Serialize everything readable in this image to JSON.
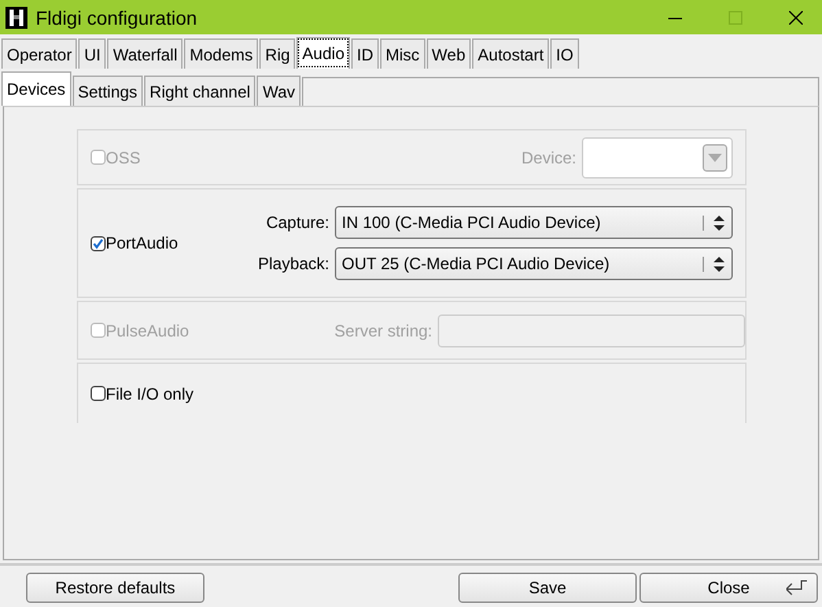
{
  "window": {
    "title": "Fldigi configuration"
  },
  "main_tabs": [
    {
      "label": "Operator",
      "selected": false
    },
    {
      "label": "UI",
      "selected": false
    },
    {
      "label": "Waterfall",
      "selected": false
    },
    {
      "label": "Modems",
      "selected": false
    },
    {
      "label": "Rig",
      "selected": false
    },
    {
      "label": "Audio",
      "selected": true
    },
    {
      "label": "ID",
      "selected": false
    },
    {
      "label": "Misc",
      "selected": false
    },
    {
      "label": "Web",
      "selected": false
    },
    {
      "label": "Autostart",
      "selected": false
    },
    {
      "label": "IO",
      "selected": false
    }
  ],
  "sub_tabs": [
    {
      "label": "Devices",
      "selected": true
    },
    {
      "label": "Settings",
      "selected": false
    },
    {
      "label": "Right channel",
      "selected": false
    },
    {
      "label": "Wav",
      "selected": false
    }
  ],
  "groups": [
    {
      "kind": "device",
      "label": "OSS",
      "checked": false,
      "disabled": true,
      "field_label": "Device:"
    },
    {
      "kind": "portaudio",
      "label": "PortAudio",
      "checked": true,
      "disabled": false,
      "capture_label": "Capture:",
      "capture_value": "IN 100 (C-Media PCI Audio Device)",
      "playback_label": "Playback:",
      "playback_value": "OUT 25 (C-Media PCI Audio Device)"
    },
    {
      "kind": "server",
      "label": "PulseAudio",
      "checked": false,
      "disabled": true,
      "field_label": "Server string:"
    },
    {
      "kind": "plain",
      "label": "File I/O only",
      "checked": false,
      "disabled": false
    }
  ],
  "buttons": [
    {
      "label": "Restore defaults"
    },
    {
      "label": "Save"
    },
    {
      "label": "Close"
    }
  ]
}
